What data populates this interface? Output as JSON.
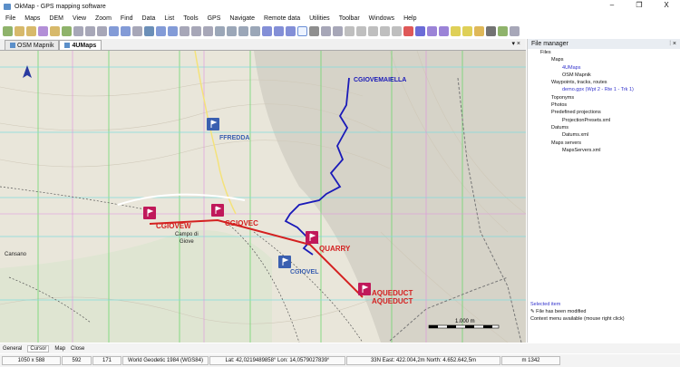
{
  "window": {
    "title": "OkMap - GPS mapping software",
    "minimize": "–",
    "maximize": "❐",
    "close": "X"
  },
  "menu": [
    "File",
    "Maps",
    "DEM",
    "View",
    "Zoom",
    "Find",
    "Data",
    "List",
    "Tools",
    "GPS",
    "Navigate",
    "Remote data",
    "Utilities",
    "Toolbar",
    "Windows",
    "Help"
  ],
  "tabs": [
    {
      "label": "OSM Mapnik"
    },
    {
      "label": "4UMaps"
    }
  ],
  "tab_close": "▾ ×",
  "map": {
    "waypoints": {
      "cgiovemaiella": "CGIOVEMAIELLA",
      "ffredda": "FFREDDA",
      "cgiovew": "CGIOVEW",
      "cgiovec": "CGIOVEC",
      "quarry": "QUARRY",
      "cgiovel": "CGIOVEL",
      "aqueduct1": "AQUEDUCT",
      "aqueduct2": "AQUEDUCT"
    },
    "places": {
      "campo": "Campo di",
      "giove": "Giove",
      "cansano": "Cansano"
    },
    "scale": "1.000 m",
    "colors": {
      "route": "#d42020",
      "track": "#1a1ab8",
      "waypoint_red": "#c0185a",
      "waypoint_blue": "#3a5fb0",
      "grid_green": "#6fd66f",
      "grid_cyan": "#7fdcdc"
    }
  },
  "file_manager": {
    "title": "File manager",
    "pin": "⫶ ×",
    "tree": [
      {
        "label": "Files",
        "level": 1
      },
      {
        "label": "Maps",
        "level": 2
      },
      {
        "label": "4UMaps",
        "level": 3,
        "highlight": true
      },
      {
        "label": "OSM Mapnik",
        "level": 3
      },
      {
        "label": "Waypoints, tracks, routes",
        "level": 2
      },
      {
        "label": "demo.gpx (Wpt 2 - Rte 1 - Trk 1)",
        "level": 3,
        "highlight": true
      },
      {
        "label": "Toponyms",
        "level": 2
      },
      {
        "label": "Photos",
        "level": 2
      },
      {
        "label": "Predefined projections",
        "level": 2
      },
      {
        "label": "ProjectionPresets.xml",
        "level": 3
      },
      {
        "label": "Datums",
        "level": 2
      },
      {
        "label": "Datums.xml",
        "level": 3
      },
      {
        "label": "Maps servers",
        "level": 2
      },
      {
        "label": "MapsServers.xml",
        "level": 3
      }
    ],
    "selected_title": "Selected item",
    "modified": "File has been modified",
    "context": "Context menu available (mouse right click)"
  },
  "bottom_tabs": [
    "General",
    "Cursor",
    "Map",
    "Close"
  ],
  "status": {
    "size": "1050 x 588",
    "x": "592",
    "y": "171",
    "datum": "World Geodetic 1984 (WGS84)",
    "latlon": "Lat: 42,0219489858°  Lon: 14,0579027839°",
    "utm": "33N  East: 422.004,2m  North: 4.652.642,5m",
    "elev": "m 1342"
  }
}
